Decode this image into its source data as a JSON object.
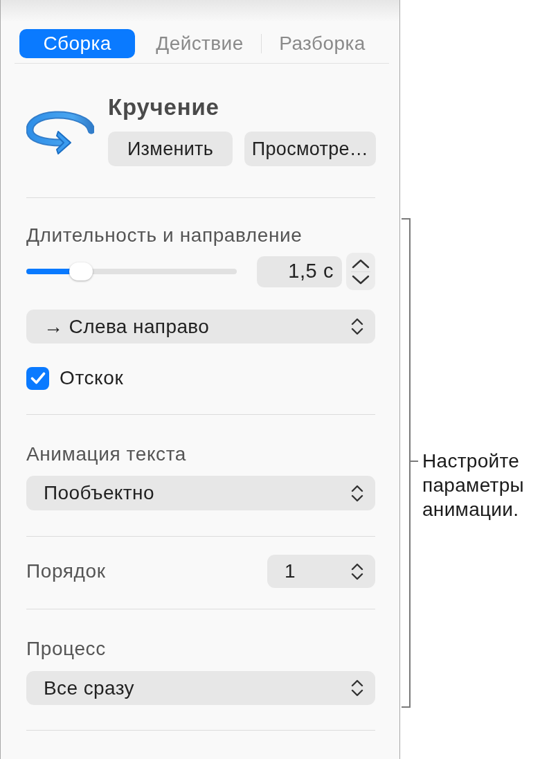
{
  "tabs": [
    {
      "label": "Сборка",
      "selected": true
    },
    {
      "label": "Действие",
      "selected": false
    },
    {
      "label": "Разборка",
      "selected": false
    }
  ],
  "effect": {
    "title": "Кручение",
    "buttons": [
      "Изменить",
      "Просмотре…"
    ]
  },
  "duration": {
    "label": "Длительность и направление",
    "slider": {
      "level": 0.26
    },
    "value": "1,5 с",
    "direction": "→ Слева направо",
    "bounce": {
      "label": "Отскок",
      "checked": true
    }
  },
  "text_animation": {
    "label": "Анимация текста",
    "value": "Пообъектно"
  },
  "order": {
    "label": "Порядок",
    "value": "1"
  },
  "delivery": {
    "label": "Процесс",
    "value": "Все сразу"
  },
  "callout": {
    "text": "Настройте параметры анимации."
  }
}
